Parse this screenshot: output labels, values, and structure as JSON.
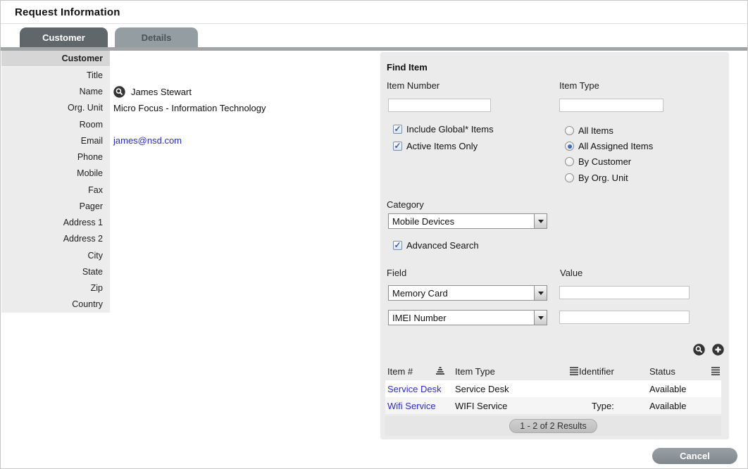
{
  "window": {
    "title": "Request Information"
  },
  "tabs": [
    {
      "label": "Customer",
      "active": true
    },
    {
      "label": "Details",
      "active": false
    }
  ],
  "customer_form": {
    "fields": [
      {
        "label": "Customer",
        "header": true
      },
      {
        "label": "Title",
        "value": ""
      },
      {
        "label": "Name",
        "value": "James Stewart",
        "icon": "search-user-icon"
      },
      {
        "label": "Org. Unit",
        "value": "Micro Focus - Information Technology"
      },
      {
        "label": "Room",
        "value": ""
      },
      {
        "label": "Email",
        "value": "james@nsd.com",
        "link": true
      },
      {
        "label": "Phone",
        "value": ""
      },
      {
        "label": "Mobile",
        "value": ""
      },
      {
        "label": "Fax",
        "value": ""
      },
      {
        "label": "Pager",
        "value": ""
      },
      {
        "label": "Address 1",
        "value": ""
      },
      {
        "label": "Address 2",
        "value": ""
      },
      {
        "label": "City",
        "value": ""
      },
      {
        "label": "State",
        "value": ""
      },
      {
        "label": "Zip",
        "value": ""
      },
      {
        "label": "Country",
        "value": ""
      }
    ]
  },
  "find_item": {
    "heading": "Find Item",
    "item_number": {
      "label": "Item Number",
      "value": ""
    },
    "item_type": {
      "label": "Item Type",
      "value": ""
    },
    "checkboxes": [
      {
        "label": "Include Global* Items",
        "checked": true
      },
      {
        "label": "Active Items Only",
        "checked": true
      }
    ],
    "radios": [
      {
        "label": "All Items",
        "selected": false
      },
      {
        "label": "All Assigned Items",
        "selected": true
      },
      {
        "label": "By Customer",
        "selected": false
      },
      {
        "label": "By Org. Unit",
        "selected": false
      }
    ],
    "category": {
      "label": "Category",
      "value": "Mobile Devices"
    },
    "advanced_search": {
      "label": "Advanced Search",
      "checked": true
    },
    "field_label": "Field",
    "value_label": "Value",
    "field_rows": [
      {
        "field": "Memory Card",
        "value": ""
      },
      {
        "field": "IMEI Number",
        "value": ""
      }
    ],
    "results": {
      "columns": [
        "Item #",
        "Item Type",
        "Identifier",
        "Status"
      ],
      "rows": [
        {
          "item_number": "Service Desk",
          "item_type": "Service Desk",
          "identifier": "",
          "status": "Available"
        },
        {
          "item_number": "Wifi Service",
          "item_type": "WIFI Service",
          "identifier": "Type:",
          "status": "Available"
        }
      ],
      "pagination": "1 - 2 of 2 Results"
    }
  },
  "footer": {
    "cancel_label": "Cancel"
  },
  "colors": {
    "link": "#2b2bd2",
    "active_tab": "#5f676b",
    "inactive_tab": "#949da1",
    "panel_bg": "#ebebeb",
    "cancel_button": "#868e93",
    "check_blue": "#3a5fb0",
    "radio_blue": "#1d4aa8"
  }
}
